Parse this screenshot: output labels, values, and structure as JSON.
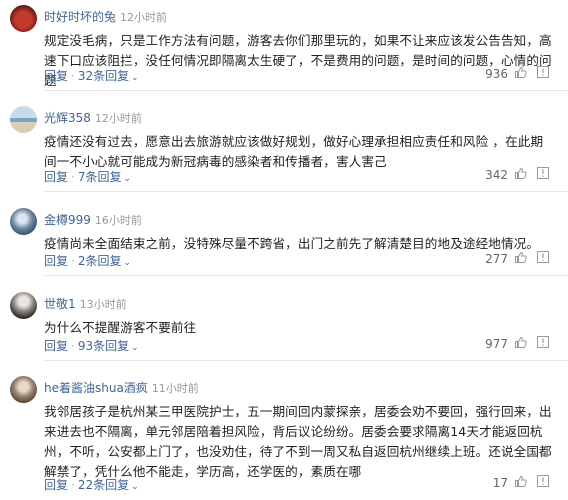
{
  "actions": {
    "reply": "回复",
    "dot": "·",
    "replies_suffix": "回复",
    "chevron": "⌄"
  },
  "comments": [
    {
      "user": "时好时坏的兔",
      "time": "12小时前",
      "text": "规定没毛病，只是工作方法有问题，游客去你们那里玩的，如果不让来应该发公告告知，高速下口应该阻拦，没任何情况即隔离太生硬了，不是费用的问题，是时间的问题，心情的问题",
      "reply_count": "32条",
      "likes": "936",
      "avatar_color": "#7a1a1a"
    },
    {
      "user": "光辉358",
      "time": "12小时前",
      "text": "疫情还没有过去，愿意出去旅游就应该做好规划，做好心理承担相应责任和风险 ，在此期间一不小心就可能成为新冠病毒的感染者和传播者，害人害己",
      "reply_count": "7条",
      "likes": "342",
      "avatar_color": "#8fb3cc"
    },
    {
      "user": "金樽999",
      "time": "16小时前",
      "text": "疫情尚未全面结束之前，没特殊尽量不跨省，出门之前先了解清楚目的地及途经地情况。",
      "reply_count": "2条",
      "likes": "277",
      "avatar_color": "#4a6a86"
    },
    {
      "user": "世敬1",
      "time": "13小时前",
      "text": "为什么不提醒游客不要前往",
      "reply_count": "93条",
      "likes": "977",
      "avatar_color": "#444444"
    },
    {
      "user": "he着酱油shua酒疯",
      "time": "11小时前",
      "text": "我邻居孩子是杭州某三甲医院护士，五一期间回内蒙探亲，居委会劝不要回，强行回来，出来进去也不隔离，单元邻居陪着担风险，背后议论纷纷。居委会要求隔离14天才能返回杭州，不听，公安都上门了，也没劝住，待了不到一周又私自返回杭州继续上班。还说全国都解禁了，凭什么他不能走，学历高，还学医的，素质在哪",
      "reply_count": "22条",
      "likes": "17",
      "avatar_color": "#6b5a4a"
    }
  ]
}
